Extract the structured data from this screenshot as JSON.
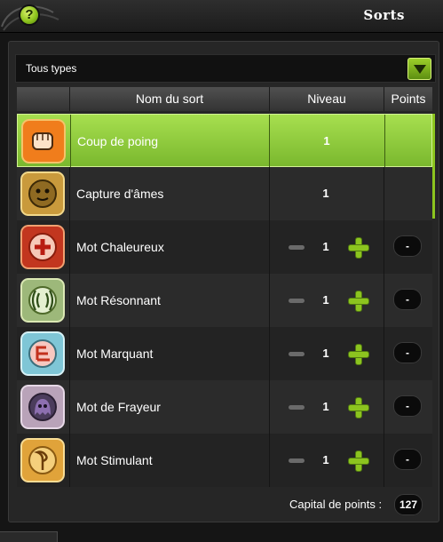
{
  "window": {
    "title": "Sorts",
    "help_label": "?"
  },
  "filter": {
    "selected": "Tous types"
  },
  "table": {
    "headers": {
      "name": "Nom du sort",
      "level": "Niveau",
      "points": "Points"
    },
    "rows": [
      {
        "name": "Coup de poing",
        "level": "1",
        "points": "",
        "icon": "fist-icon",
        "has_controls": false,
        "selected": true
      },
      {
        "name": "Capture d'âmes",
        "level": "1",
        "points": "",
        "icon": "soul-capture-icon",
        "has_controls": false,
        "selected": false
      },
      {
        "name": "Mot Chaleureux",
        "level": "1",
        "points": "-",
        "icon": "heal-cross-icon",
        "has_controls": true,
        "selected": false
      },
      {
        "name": "Mot Résonnant",
        "level": "1",
        "points": "-",
        "icon": "sound-wave-icon",
        "has_controls": true,
        "selected": false
      },
      {
        "name": "Mot Marquant",
        "level": "1",
        "points": "-",
        "icon": "mark-icon",
        "has_controls": true,
        "selected": false
      },
      {
        "name": "Mot de Frayeur",
        "level": "1",
        "points": "-",
        "icon": "fear-ghost-icon",
        "has_controls": true,
        "selected": false
      },
      {
        "name": "Mot Stimulant",
        "level": "1",
        "points": "-",
        "icon": "sprout-icon",
        "has_controls": true,
        "selected": false
      }
    ]
  },
  "capital": {
    "label": "Capital de points :",
    "value": "127"
  },
  "colors": {
    "accent": "#8cc41f",
    "selected_row": "#a7df4f",
    "background": "#151515"
  }
}
